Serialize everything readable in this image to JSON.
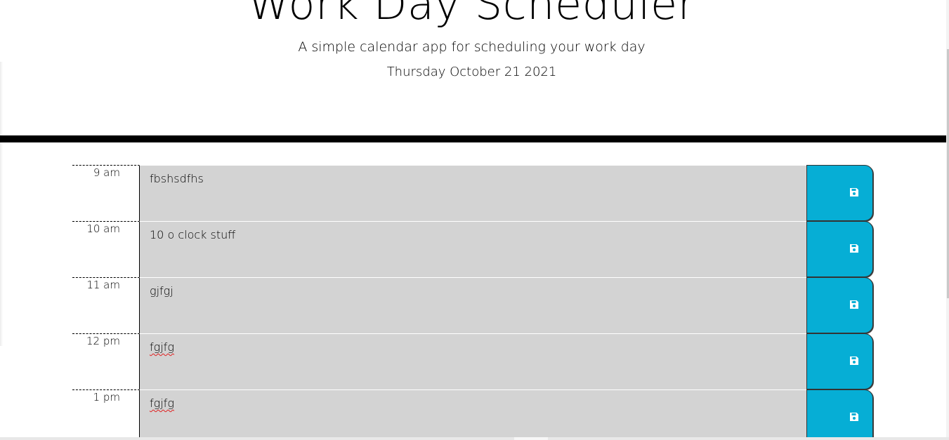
{
  "header": {
    "title": "Work Day Scheduler",
    "subtitle": "A simple calendar app for scheduling your work day",
    "current_day": "Thursday October 21 2021"
  },
  "colors": {
    "accent": "#06aed5",
    "description_bg": "#d3d3d3",
    "divider": "#000000"
  },
  "rows": [
    {
      "hour": "9 am",
      "text": "fbshsdfhs",
      "spell_flag": false,
      "save_icon": "floppy-disk-icon"
    },
    {
      "hour": "10 am",
      "text": "10 o clock stuff",
      "spell_flag": false,
      "save_icon": "floppy-disk-icon"
    },
    {
      "hour": "11 am",
      "text": "gjfgj",
      "spell_flag": false,
      "save_icon": "floppy-disk-icon"
    },
    {
      "hour": "12 pm",
      "text": "fgjfg",
      "spell_flag": true,
      "save_icon": "floppy-disk-icon"
    },
    {
      "hour": "1 pm",
      "text": "fgjfg",
      "spell_flag": true,
      "save_icon": "floppy-disk-icon"
    }
  ]
}
